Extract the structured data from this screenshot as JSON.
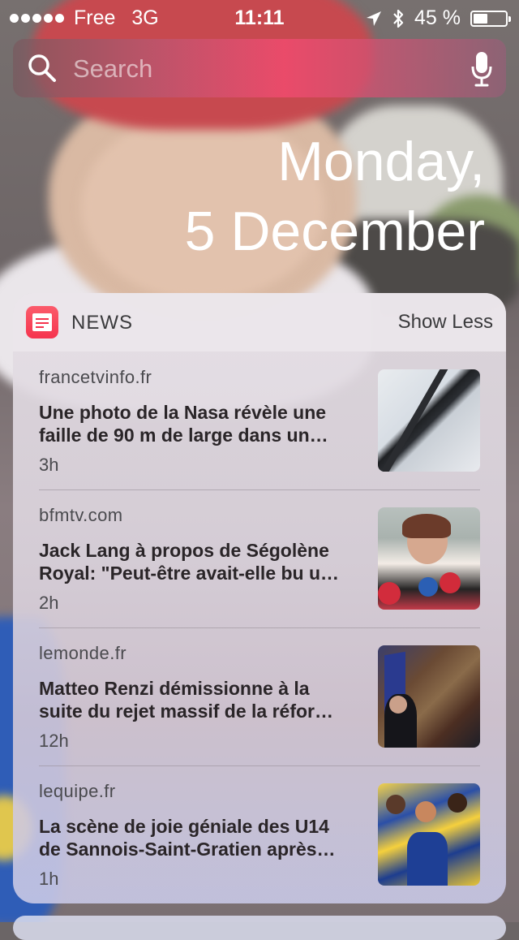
{
  "status_bar": {
    "carrier": "Free",
    "network": "3G",
    "time": "11:11",
    "battery_percent": "45 %",
    "battery_level": 0.45,
    "icons": [
      "signal-dots-icon",
      "location-arrow-icon",
      "bluetooth-icon",
      "battery-icon"
    ]
  },
  "search": {
    "placeholder": "Search",
    "value": ""
  },
  "date": {
    "weekday": "Monday,",
    "day_month": "5 December"
  },
  "news_widget": {
    "title": "NEWS",
    "toggle_label": "Show Less",
    "items": [
      {
        "source": "francetvinfo.fr",
        "headline": "Une photo de la Nasa révèle une faille de 90 m de large dans un…",
        "age": "3h"
      },
      {
        "source": "bfmtv.com",
        "headline": "Jack Lang à propos de Ségolène Royal: \"Peut-être avait-elle bu u…",
        "age": "2h"
      },
      {
        "source": "lemonde.fr",
        "headline": "Matteo Renzi démissionne à la suite du rejet massif de la réfor…",
        "age": "12h"
      },
      {
        "source": "lequipe.fr",
        "headline": "La scène de joie géniale des U14 de Sannois-Saint-Gratien après…",
        "age": "1h"
      }
    ]
  },
  "colors": {
    "accent_news_red": "#f5344e",
    "text_primary": "#2a2528",
    "text_secondary": "#4a4a4e"
  }
}
